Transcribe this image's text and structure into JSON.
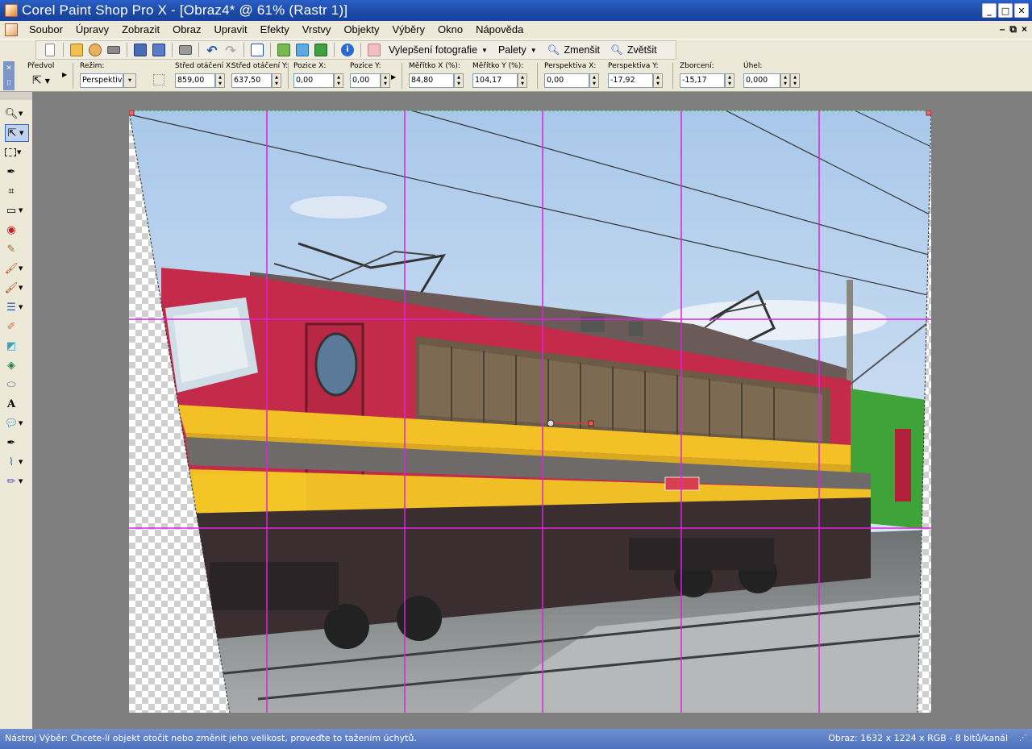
{
  "window": {
    "title": "Corel Paint Shop Pro X - [Obraz4* @  61% (Rastr 1)]"
  },
  "menu": [
    "Soubor",
    "Úpravy",
    "Zobrazit",
    "Obraz",
    "Upravit",
    "Efekty",
    "Vrstvy",
    "Objekty",
    "Výběry",
    "Okno",
    "Nápověda"
  ],
  "toolbar": {
    "photo_enhance": "Vylepšení fotografie",
    "palettes": "Palety",
    "zoom_out": "Zmenšit",
    "zoom_in": "Zvětšit"
  },
  "options": {
    "preset_label": "Předvol",
    "mode_label": "Režim:",
    "mode_value": "Perspektiva",
    "center_x_label": "Střed otáčení X:",
    "center_x": "859,00",
    "center_y_label": "Střed otáčení Y:",
    "center_y": "637,50",
    "pos_x_label": "Pozice X:",
    "pos_x": "0,00",
    "pos_y_label": "Pozice Y:",
    "pos_y": "0,00",
    "scale_x_label": "Měřítko X (%):",
    "scale_x": "84,80",
    "scale_y_label": "Měřítko Y (%):",
    "scale_y": "104,17",
    "persp_x_label": "Perspektiva X:",
    "persp_x": "0,00",
    "persp_y_label": "Perspektiva Y:",
    "persp_y": "-17,92",
    "shear_label": "Zborcení:",
    "shear": "-15,17",
    "angle_label": "Úhel:",
    "angle": "0,000"
  },
  "tools": [
    "zoom-icon",
    "pick-icon",
    "selection-icon",
    "dropper-icon",
    "crop-icon",
    "straighten-icon",
    "red-eye-icon",
    "clone-icon",
    "paint-brush-icon",
    "airbrush-icon",
    "lighten-icon",
    "eraser-icon",
    "fill-icon",
    "shapes-icon",
    "eraser2-icon",
    "text-icon",
    "preset-shape-icon",
    "pen-icon",
    "warp-brush-icon",
    "art-media-icon"
  ],
  "status": {
    "hint": "Nástroj Výběr: Chcete-li objekt otočit nebo změnit jeho velikost, proveďte to tažením úchytů.",
    "image_info": "Obraz:  1632 x 1224 x RGB - 8 bitů/kanál"
  }
}
